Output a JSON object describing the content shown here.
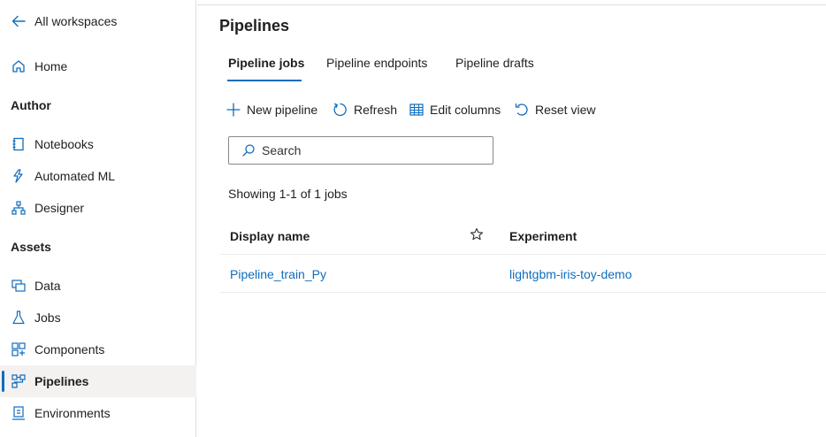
{
  "sidebar": {
    "back_label": "All workspaces",
    "home_label": "Home",
    "author_heading": "Author",
    "author_items": [
      {
        "label": "Notebooks"
      },
      {
        "label": "Automated ML"
      },
      {
        "label": "Designer"
      }
    ],
    "assets_heading": "Assets",
    "assets_items": [
      {
        "label": "Data"
      },
      {
        "label": "Jobs"
      },
      {
        "label": "Components"
      },
      {
        "label": "Pipelines",
        "active": true
      },
      {
        "label": "Environments"
      }
    ]
  },
  "main": {
    "title": "Pipelines",
    "tabs": [
      {
        "label": "Pipeline jobs",
        "active": true
      },
      {
        "label": "Pipeline endpoints"
      },
      {
        "label": "Pipeline drafts"
      }
    ],
    "toolbar": {
      "new_pipeline": "New pipeline",
      "refresh": "Refresh",
      "edit_columns": "Edit columns",
      "reset_view": "Reset view"
    },
    "search": {
      "placeholder": "Search",
      "value": ""
    },
    "count_text": "Showing 1-1 of 1 jobs",
    "table": {
      "columns": [
        "Display name",
        "Experiment"
      ],
      "rows": [
        {
          "display_name": "Pipeline_train_Py",
          "experiment": "lightgbm-iris-toy-demo"
        }
      ]
    }
  },
  "colors": {
    "accent": "#0f6cbd",
    "text": "#201f1e",
    "active_bg": "#f3f2f1",
    "border": "#e1dfdd"
  },
  "icons": {
    "back": "arrow-left-icon",
    "home": "home-icon",
    "notebooks": "notebook-icon",
    "automated_ml": "automated-ml-icon",
    "designer": "designer-icon",
    "data": "data-icon",
    "jobs": "flask-icon",
    "components": "components-icon",
    "pipelines": "pipeline-icon",
    "environments": "environment-icon",
    "new_pipeline": "plus-icon",
    "refresh": "refresh-icon",
    "edit_columns": "edit-columns-icon",
    "reset_view": "reset-icon",
    "search": "search-icon",
    "favorite": "star-icon"
  }
}
